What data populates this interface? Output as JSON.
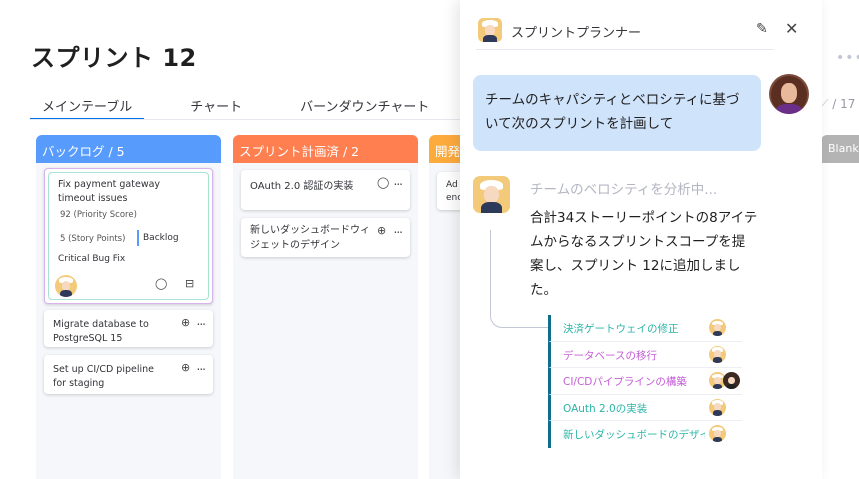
{
  "board": {
    "title": "スプリント 12",
    "tabs": [
      "メインテーブル",
      "チャート",
      "バーンダウンチャート"
    ],
    "add_tab": "+",
    "counter": "/ 17",
    "blank_label": "Blank",
    "more": "..."
  },
  "columns": [
    {
      "title": "バックログ / 5",
      "color": "#579bfc"
    },
    {
      "title": "スプリント計画済 / 2",
      "color": "#ff7f50"
    },
    {
      "title": "開発",
      "color": "#fdab3d"
    }
  ],
  "backlog_cards": [
    {
      "title": "Fix payment gateway timeout issues",
      "priority": "92 (Priority Score)",
      "story_points": "5 (Story Points)",
      "status": "Backlog",
      "tag": "Critical Bug Fix"
    },
    {
      "title": "Migrate database to PostgreSQL 15"
    },
    {
      "title": "Set up CI/CD pipeline for staging"
    }
  ],
  "planned_cards": [
    {
      "title": "OAuth 2.0 認証の実装"
    },
    {
      "title": "新しいダッシュボードウィジェットのデザイン"
    }
  ],
  "dev_cards": [
    {
      "title": "Ad\nenc"
    }
  ],
  "panel": {
    "title": "スプリントプランナー",
    "user_message": "チームのキャパシティとベロシティに基づいて次のスプリントを計画して",
    "thinking": "チームのベロシティを分析中...",
    "answer": "合計34ストーリーポイントの8アイテムからなるスプリントスコープを提案し、スプリント 12に追加しました。",
    "items": [
      {
        "label": "決済ゲートウェイの修正",
        "color": "#2bb5a8"
      },
      {
        "label": "データベースの移行",
        "color": "#c45ed6"
      },
      {
        "label": "CI/CDパイプラインの構築",
        "color": "#c45ed6"
      },
      {
        "label": "OAuth 2.0の実装",
        "color": "#2bb5a8"
      },
      {
        "label": "新しいダッシュボードのデザイン",
        "color": "#2bb5a8"
      }
    ]
  },
  "icons": {
    "comment": "comment-icon",
    "subitems": "subitems-icon",
    "add_update": "add-update-icon",
    "edit": "edit-icon",
    "close": "close-icon"
  }
}
